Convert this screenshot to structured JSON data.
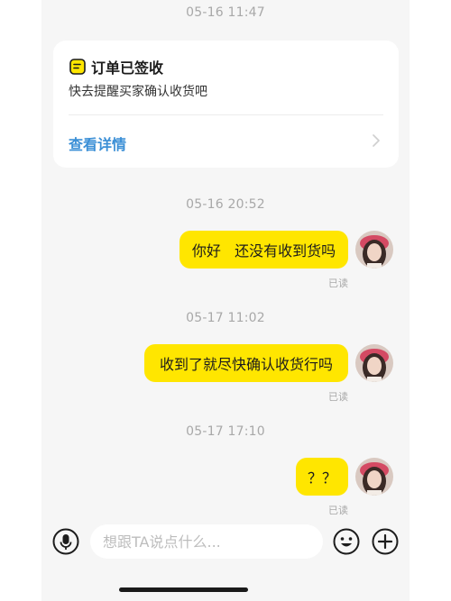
{
  "chat": {
    "timestamps": [
      "05-16 11:47",
      "05-16 20:52",
      "05-17 11:02",
      "05-17 17:10"
    ],
    "card": {
      "title": "订单已签收",
      "subtitle": "快去提醒买家确认收货吧",
      "link": "查看详情",
      "icon": "order-receipt-icon"
    },
    "messages": [
      {
        "text": "你好   还没有收到货吗",
        "status": "已读"
      },
      {
        "text": "收到了就尽快确认收货行吗",
        "status": "已读"
      },
      {
        "text": "？？",
        "status": "已读"
      }
    ]
  },
  "input_bar": {
    "placeholder": "想跟TA说点什么...",
    "voice_icon": "microphone-icon",
    "emoji_icon": "emoji-icon",
    "plus_icon": "plus-icon"
  },
  "colors": {
    "bubble": "#ffe600",
    "link": "#3b8fd6",
    "background": "#f6f6f6"
  }
}
